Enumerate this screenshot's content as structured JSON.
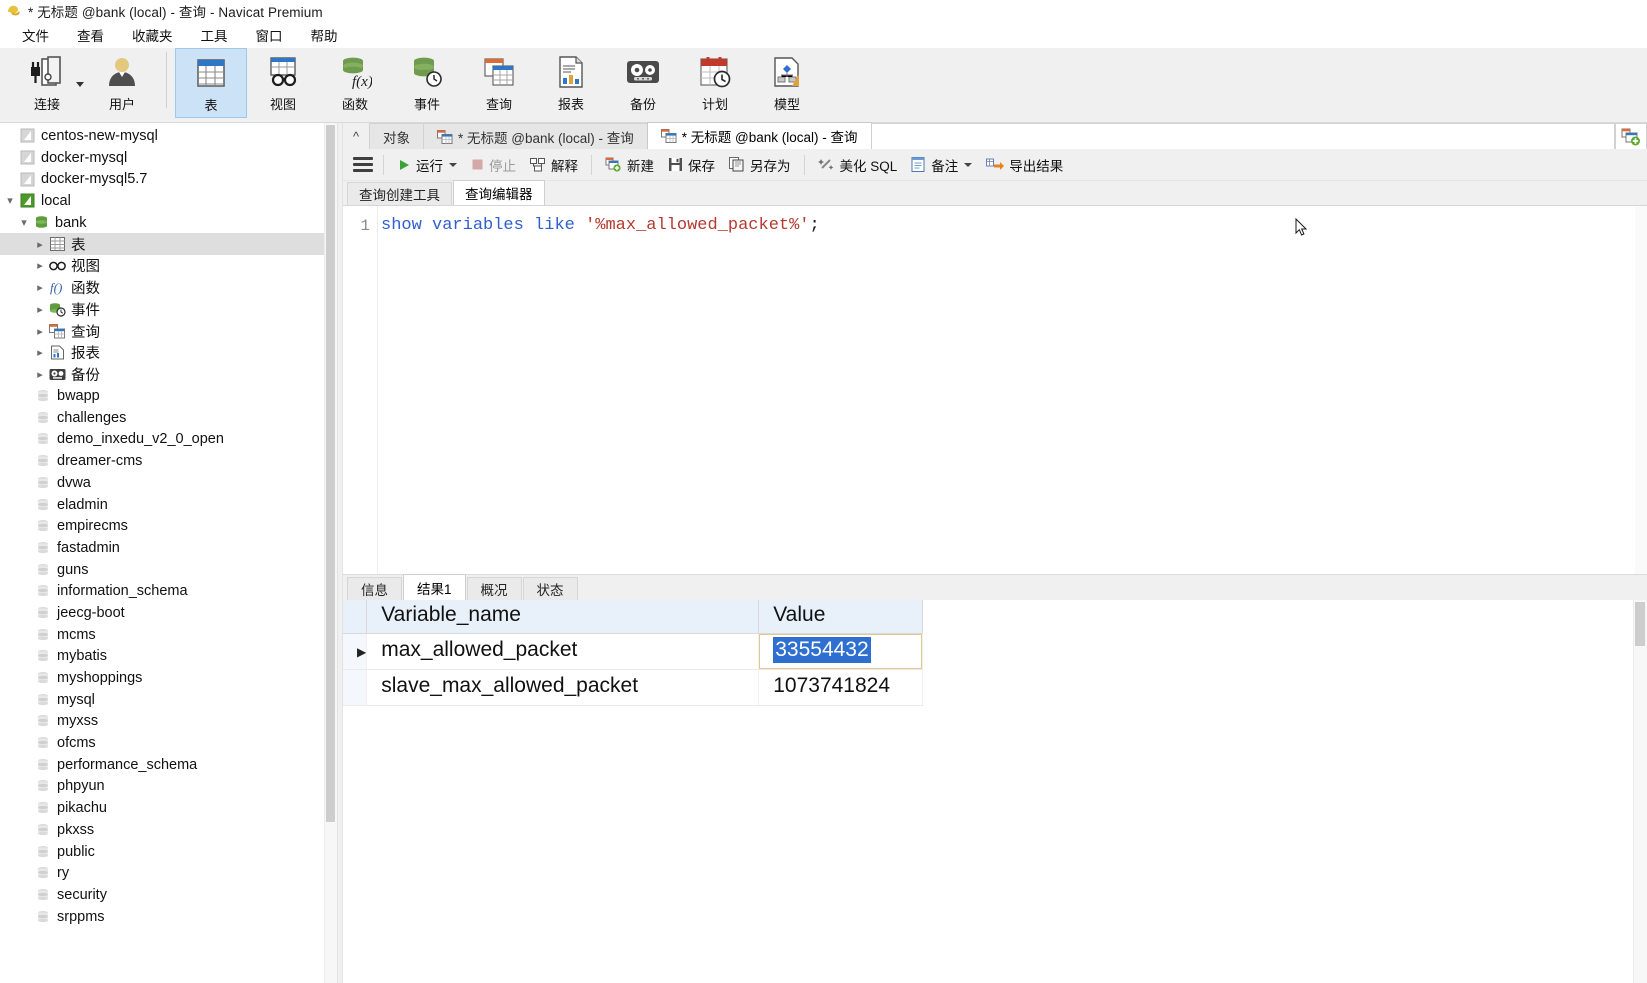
{
  "window": {
    "title": "* 无标题 @bank (local) - 查询 - Navicat Premium",
    "app_icon": "navicat-logo-icon"
  },
  "menubar": {
    "items": [
      {
        "label": "文件",
        "name": "menu-file"
      },
      {
        "label": "查看",
        "name": "menu-view"
      },
      {
        "label": "收藏夹",
        "name": "menu-favorites"
      },
      {
        "label": "工具",
        "name": "menu-tools"
      },
      {
        "label": "窗口",
        "name": "menu-window"
      },
      {
        "label": "帮助",
        "name": "menu-help"
      }
    ]
  },
  "ribbon": {
    "buttons": [
      {
        "label": "连接",
        "name": "ribbon-connection",
        "icon": "plug-server-icon",
        "has_caret": true,
        "active": false
      },
      {
        "label": "用户",
        "name": "ribbon-user",
        "icon": "user-icon",
        "has_caret": false,
        "active": false
      },
      {
        "label": "表",
        "name": "ribbon-table",
        "icon": "table-icon",
        "has_caret": false,
        "active": true
      },
      {
        "label": "视图",
        "name": "ribbon-view",
        "icon": "view-glasses-icon",
        "has_caret": false,
        "active": false
      },
      {
        "label": "函数",
        "name": "ribbon-function",
        "icon": "function-fx-icon",
        "has_caret": false,
        "active": false
      },
      {
        "label": "事件",
        "name": "ribbon-event",
        "icon": "event-clock-icon",
        "has_caret": false,
        "active": false
      },
      {
        "label": "查询",
        "name": "ribbon-query",
        "icon": "query-icon",
        "has_caret": false,
        "active": false
      },
      {
        "label": "报表",
        "name": "ribbon-report",
        "icon": "report-chart-icon",
        "has_caret": false,
        "active": false
      },
      {
        "label": "备份",
        "name": "ribbon-backup",
        "icon": "backup-tape-icon",
        "has_caret": false,
        "active": false
      },
      {
        "label": "计划",
        "name": "ribbon-schedule",
        "icon": "calendar-clock-icon",
        "has_caret": false,
        "active": false
      },
      {
        "label": "模型",
        "name": "ribbon-model",
        "icon": "model-diagram-icon",
        "has_caret": false,
        "active": false
      }
    ]
  },
  "sidebar": {
    "connections": [
      {
        "label": "centos-new-mysql",
        "icon": "connection-icon",
        "level": 1,
        "expandable": false,
        "expanded": false,
        "selected": false
      },
      {
        "label": "docker-mysql",
        "icon": "connection-icon",
        "level": 1,
        "expandable": false,
        "expanded": false,
        "selected": false
      },
      {
        "label": "docker-mysql5.7",
        "icon": "connection-icon",
        "level": 1,
        "expandable": false,
        "expanded": false,
        "selected": false
      },
      {
        "label": "local",
        "icon": "connection-open-icon",
        "level": 1,
        "expandable": true,
        "expanded": true,
        "selected": false
      },
      {
        "label": "bank",
        "icon": "database-open-icon",
        "level": 2,
        "expandable": true,
        "expanded": true,
        "selected": false
      },
      {
        "label": "表",
        "icon": "table-icon",
        "level": 3,
        "expandable": true,
        "expanded": false,
        "selected": true
      },
      {
        "label": "视图",
        "icon": "view-glasses-icon",
        "level": 3,
        "expandable": true,
        "expanded": false,
        "selected": false
      },
      {
        "label": "函数",
        "icon": "function-fx-icon",
        "level": 3,
        "expandable": true,
        "expanded": false,
        "selected": false
      },
      {
        "label": "事件",
        "icon": "event-clock-icon",
        "level": 3,
        "expandable": true,
        "expanded": false,
        "selected": false
      },
      {
        "label": "查询",
        "icon": "query-icon",
        "level": 3,
        "expandable": true,
        "expanded": false,
        "selected": false
      },
      {
        "label": "报表",
        "icon": "report-chart-icon",
        "level": 3,
        "expandable": true,
        "expanded": false,
        "selected": false
      },
      {
        "label": "备份",
        "icon": "backup-tape-icon",
        "level": 3,
        "expandable": true,
        "expanded": false,
        "selected": false
      }
    ],
    "databases": [
      {
        "label": "bwapp",
        "icon": "database-icon"
      },
      {
        "label": "challenges",
        "icon": "database-icon"
      },
      {
        "label": "demo_inxedu_v2_0_open",
        "icon": "database-icon"
      },
      {
        "label": "dreamer-cms",
        "icon": "database-icon"
      },
      {
        "label": "dvwa",
        "icon": "database-icon"
      },
      {
        "label": "eladmin",
        "icon": "database-icon"
      },
      {
        "label": "empirecms",
        "icon": "database-icon"
      },
      {
        "label": "fastadmin",
        "icon": "database-icon"
      },
      {
        "label": "guns",
        "icon": "database-icon"
      },
      {
        "label": "information_schema",
        "icon": "database-icon"
      },
      {
        "label": "jeecg-boot",
        "icon": "database-icon"
      },
      {
        "label": "mcms",
        "icon": "database-icon"
      },
      {
        "label": "mybatis",
        "icon": "database-icon"
      },
      {
        "label": "myshoppings",
        "icon": "database-icon"
      },
      {
        "label": "mysql",
        "icon": "database-icon"
      },
      {
        "label": "myxss",
        "icon": "database-icon"
      },
      {
        "label": "ofcms",
        "icon": "database-icon"
      },
      {
        "label": "performance_schema",
        "icon": "database-icon"
      },
      {
        "label": "phpyun",
        "icon": "database-icon"
      },
      {
        "label": "pikachu",
        "icon": "database-icon"
      },
      {
        "label": "pkxss",
        "icon": "database-icon"
      },
      {
        "label": "public",
        "icon": "database-icon"
      },
      {
        "label": "ry",
        "icon": "database-icon"
      },
      {
        "label": "security",
        "icon": "database-icon"
      },
      {
        "label": "srppms",
        "icon": "database-icon"
      }
    ]
  },
  "doc_tabs": {
    "collapse_icon": "chevron-up-icon",
    "items": [
      {
        "label": "对象",
        "name": "tab-objects",
        "icon": "none",
        "active": false
      },
      {
        "label": "* 无标题 @bank (local) - 查询",
        "name": "tab-query-1",
        "icon": "query-icon",
        "active": false
      },
      {
        "label": "* 无标题 @bank (local) - 查询",
        "name": "tab-query-2",
        "icon": "query-icon",
        "active": true
      }
    ],
    "new_tab_icon": "new-query-tab-icon"
  },
  "query_toolbar": {
    "menu_icon": "hamburger-menu-icon",
    "items": [
      {
        "label": "运行",
        "name": "run-button",
        "icon": "play-triangle-icon",
        "disabled": false,
        "caret": true
      },
      {
        "label": "停止",
        "name": "stop-button",
        "icon": "stop-square-icon",
        "disabled": true,
        "caret": false
      },
      {
        "label": "解释",
        "name": "explain-button",
        "icon": "explain-icon",
        "disabled": false,
        "caret": false
      },
      {
        "label": "新建",
        "name": "new-button",
        "icon": "new-query-icon",
        "disabled": false,
        "caret": false
      },
      {
        "label": "保存",
        "name": "save-button",
        "icon": "floppy-save-icon",
        "disabled": false,
        "caret": false
      },
      {
        "label": "另存为",
        "name": "save-as-button",
        "icon": "save-as-icon",
        "disabled": false,
        "caret": false
      },
      {
        "label": "美化 SQL",
        "name": "beautify-sql-button",
        "icon": "magic-wand-icon",
        "disabled": false,
        "caret": false
      },
      {
        "label": "备注",
        "name": "comment-button",
        "icon": "note-icon",
        "disabled": false,
        "caret": true
      },
      {
        "label": "导出结果",
        "name": "export-result-button",
        "icon": "export-arrow-icon",
        "disabled": false,
        "caret": false
      }
    ]
  },
  "editor_tabs": {
    "items": [
      {
        "label": "查询创建工具",
        "name": "tab-query-builder",
        "active": false
      },
      {
        "label": "查询编辑器",
        "name": "tab-query-editor",
        "active": true
      }
    ]
  },
  "editor": {
    "line_number": "1",
    "sql_tokens": [
      {
        "text": "show",
        "type": "kw"
      },
      {
        "text": " ",
        "type": "plain"
      },
      {
        "text": "variables",
        "type": "kw"
      },
      {
        "text": " ",
        "type": "plain"
      },
      {
        "text": "like",
        "type": "kw"
      },
      {
        "text": " ",
        "type": "plain"
      },
      {
        "text": "'%max_allowed_packet%'",
        "type": "str"
      },
      {
        "text": ";",
        "type": "plain"
      }
    ],
    "sql_full": "show variables like '%max_allowed_packet%';"
  },
  "result_tabs": {
    "items": [
      {
        "label": "信息",
        "name": "tab-info",
        "active": false
      },
      {
        "label": "结果1",
        "name": "tab-result-1",
        "active": true
      },
      {
        "label": "概况",
        "name": "tab-profile",
        "active": false
      },
      {
        "label": "状态",
        "name": "tab-status",
        "active": false
      }
    ]
  },
  "result_grid": {
    "columns": [
      "Variable_name",
      "Value"
    ],
    "rows": [
      {
        "variable_name": "max_allowed_packet",
        "value": "33554432",
        "current": true,
        "value_selected": true
      },
      {
        "variable_name": "slave_max_allowed_packet",
        "value": "1073741824",
        "current": false,
        "value_selected": false
      }
    ]
  },
  "colors": {
    "accent_selection": "#2f6fd0",
    "ribbon_active": "#cce2f6",
    "header_bg": "#e8f0f9",
    "tree_selected": "#dedede",
    "sql_keyword": "#2f5fd0",
    "sql_string": "#b5392f"
  }
}
